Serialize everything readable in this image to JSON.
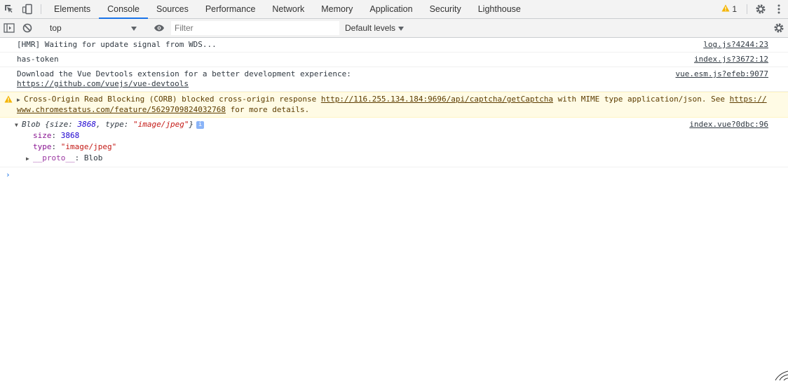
{
  "tabbar": {
    "tabs": [
      "Elements",
      "Console",
      "Sources",
      "Performance",
      "Network",
      "Memory",
      "Application",
      "Security",
      "Lighthouse"
    ],
    "active_tab": "Console",
    "warning_count": "1",
    "icons": [
      "inspect-element-icon",
      "device-toolbar-icon",
      "warning-icon",
      "gear-icon",
      "kebab-menu-icon"
    ]
  },
  "toolbar": {
    "context": "top",
    "filter_placeholder": "Filter",
    "levels": "Default levels",
    "icons": [
      "sidebar-toggle-icon",
      "clear-console-icon",
      "chevron-down-icon",
      "eye-icon",
      "gear-icon"
    ]
  },
  "console": {
    "messages": [
      {
        "text": "[HMR] Waiting for update signal from WDS...",
        "source": "log.js?4244:23"
      },
      {
        "text": "has-token",
        "source": "index.js?3672:12"
      },
      {
        "text": "Download the Vue Devtools extension for a better development experience:",
        "link": "https://github.com/vuejs/vue-devtools",
        "source": "vue.esm.js?efeb:9077"
      }
    ],
    "warning": {
      "prefix": "Cross-Origin Read Blocking (CORB) blocked cross-origin response ",
      "url": "http://116.255.134.184:9696/api/captcha/getCaptcha",
      "middle": " with MIME type application/json. See ",
      "link": "https://www.chromestatus.com/feature/5629709824032768",
      "suffix": " for more details."
    },
    "object": {
      "name": "Blob",
      "preview_open": " {",
      "k_size": "size",
      "v_size": "3868",
      "k_type": "type",
      "v_type": "\"image/jpeg\"",
      "preview_close": "}",
      "source": "index.vue?0dbc:96",
      "proto_key": "__proto__",
      "proto_value": "Blob",
      "colon": ": ",
      "comma": ", "
    },
    "prompt": "›"
  }
}
